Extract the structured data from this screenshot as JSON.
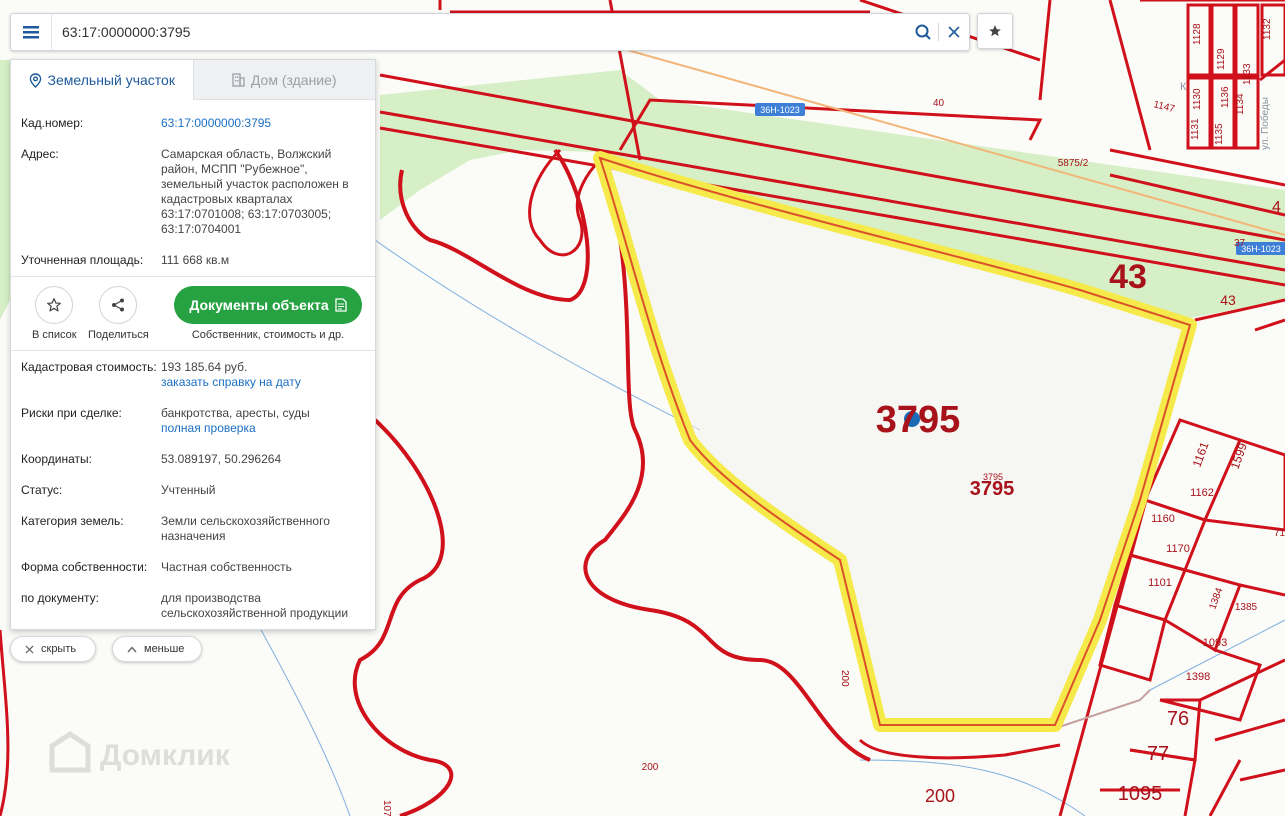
{
  "search": {
    "value": "63:17:0000000:3795",
    "placeholder": ""
  },
  "tabs": [
    {
      "label": "Земельный участок",
      "icon": "map-pin-icon",
      "active": true
    },
    {
      "label": "Дом (здание)",
      "icon": "building-icon",
      "active": false
    }
  ],
  "details": {
    "cad_number": {
      "label": "Кад.номер:",
      "value": "63:17:0000000:3795"
    },
    "address": {
      "label": "Адрес:",
      "value": "Самарская область, Волжский район, МСПП \"Рубежное\", земельный участок расположен в кадастровых кварталах 63:17:0701008; 63:17:0703005; 63:17:0704001"
    },
    "area": {
      "label": "Уточненная площадь:",
      "value": "111 668 кв.м"
    },
    "cad_value": {
      "label": "Кадастровая стоимость:",
      "value": "193 185.64 руб.",
      "link": "заказать справку на дату"
    },
    "risks": {
      "label": "Риски при сделке:",
      "value": "банкротства, аресты, суды",
      "link": "полная проверка"
    },
    "coords": {
      "label": "Координаты:",
      "value": "53.089197, 50.296264"
    },
    "status": {
      "label": "Статус:",
      "value": "Учтенный"
    },
    "category": {
      "label": "Категория земель:",
      "value": "Земли сельскохозяйственного назначения"
    },
    "ownership": {
      "label": "Форма собственности:",
      "value": "Частная собственность"
    },
    "by_document": {
      "label": "по документу:",
      "value": "для производства сельскохозяйственной продукции"
    }
  },
  "actions": {
    "add_list": "В список",
    "share": "Поделиться",
    "documents": "Документы объекта",
    "documents_note": "Собственник, стоимость и др."
  },
  "controls": {
    "hide": "скрыть",
    "less": "меньше"
  },
  "brand": {
    "watermark": "Домклик"
  },
  "colors": {
    "parcel_border": "#d0101a",
    "highlight": "#f6ea4a",
    "accent_button": "#27a243",
    "link": "#1a6fc4",
    "green_zone": "#d6efc6",
    "road_badge": "#3d7fd6"
  },
  "map_labels": {
    "main_parcel": "3795",
    "main_parcel_small": "3795",
    "parcel_43_big": "43",
    "parcel_43_small": "43",
    "road_badge_1": "36Н-1023",
    "road_badge_2": "36Н-1023",
    "street": "ул. Победы",
    "street_partial": "К",
    "n1147": "1147",
    "n40": "40",
    "n5875": "5875/2",
    "n37": "37",
    "n200a": "200",
    "n200b": "200",
    "n200c": "200",
    "n1161": "1161",
    "n1599": "1599",
    "n1162": "1162",
    "n1160": "1160",
    "n1170": "1170",
    "n1101": "1101",
    "n1384": "1384",
    "n1385": "1385",
    "n1093": "1093",
    "n1398": "1398",
    "n76": "76",
    "n77": "77",
    "n1095": "1095",
    "n1128": "1128",
    "n1129": "1129",
    "n1130": "1130",
    "n1131": "1131",
    "n1132": "1132",
    "n1133": "1133",
    "n1134": "1134",
    "n1135": "1135",
    "n1136": "1136",
    "n71": "71",
    "n4": "4",
    "n107": "107"
  }
}
